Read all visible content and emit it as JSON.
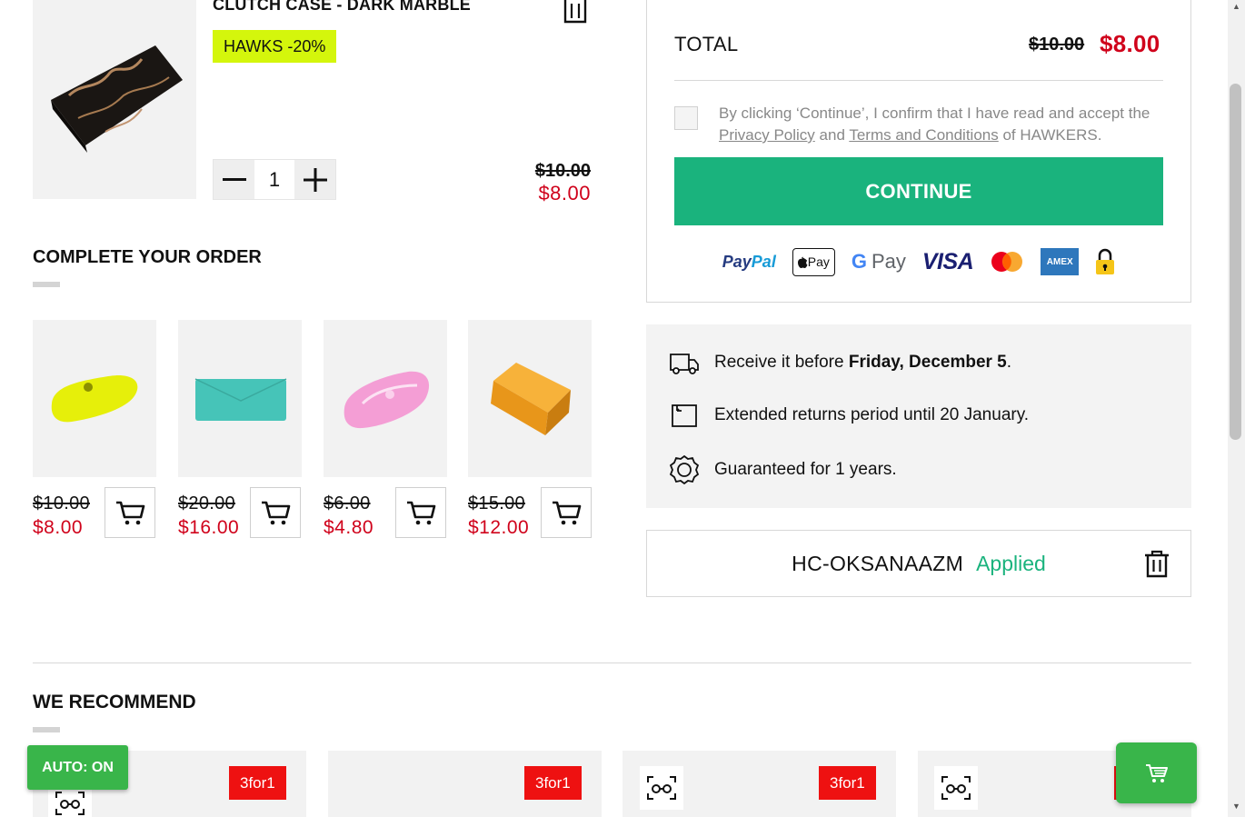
{
  "cart_item": {
    "title": "CLUTCH CASE - DARK MARBLE",
    "promo": "HAWKS -20%",
    "quantity": "1",
    "old_price": "$10.00",
    "new_price": "$8.00"
  },
  "complete_order": {
    "heading": "COMPLETE YOUR ORDER",
    "products": [
      {
        "old_price": "$10.00",
        "new_price": "$8.00",
        "color": "#e6ef0a"
      },
      {
        "old_price": "$20.00",
        "new_price": "$16.00",
        "color": "#46c4b8"
      },
      {
        "old_price": "$6.00",
        "new_price": "$4.80",
        "color": "#f58fd0"
      },
      {
        "old_price": "$15.00",
        "new_price": "$12.00",
        "color": "#f2a024"
      }
    ]
  },
  "summary": {
    "total_label": "TOTAL",
    "total_old": "$10.00",
    "total_new": "$8.00",
    "consent_pre": "By clicking ‘Continue’, I confirm that I have read and accept the ",
    "privacy_link": "Privacy Policy",
    "consent_and": " and ",
    "terms_link": "Terms and Conditions",
    "consent_post": " of HAWKERS.",
    "continue_label": "CONTINUE",
    "payment_methods": [
      "PayPal",
      "Apple Pay",
      "G Pay",
      "VISA",
      "Mastercard",
      "AMEX",
      "Secure lock"
    ]
  },
  "info": {
    "delivery_pre": "Receive it before ",
    "delivery_date": "Friday, December 5",
    "delivery_post": ".",
    "returns": "Extended returns period until 20 January.",
    "guarantee": "Guaranteed for 1 years."
  },
  "coupon": {
    "code": "HC-OKSANAAZM",
    "status": "Applied"
  },
  "recommend": {
    "heading": "WE RECOMMEND",
    "badge": "3for1"
  },
  "auto_toggle": "AUTO: ON",
  "colors": {
    "accent_green": "#1ab37d",
    "price_red": "#d0021b",
    "promo_yellow": "#d4f60c",
    "badge_red": "#ee1111",
    "fab_green": "#39b54a"
  }
}
